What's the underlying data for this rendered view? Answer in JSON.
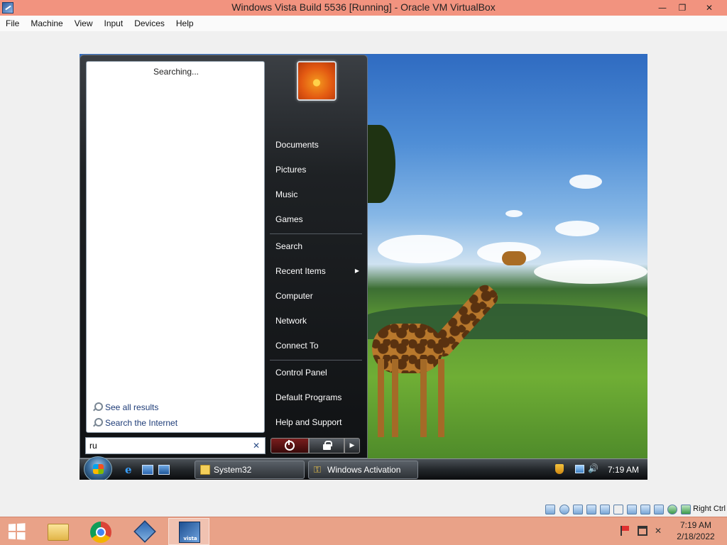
{
  "vbox": {
    "window_title": "Windows Vista Build 5536 [Running] - Oracle VM VirtualBox",
    "menu": [
      "File",
      "Machine",
      "View",
      "Input",
      "Devices",
      "Help"
    ],
    "controls": {
      "minimize": "—",
      "restore": "❐",
      "close": "✕"
    },
    "status": {
      "host_key": "Right Ctrl"
    }
  },
  "start_menu": {
    "searching_text": "Searching...",
    "search_links": [
      "See all results",
      "Search the Internet"
    ],
    "search_value": "ru",
    "clear_glyph": "✕",
    "user_name": "",
    "right_items": [
      "Documents",
      "Pictures",
      "Music",
      "Games"
    ],
    "right_items_2": [
      "Search",
      "Recent Items",
      "Computer",
      "Network",
      "Connect To"
    ],
    "right_items_3": [
      "Control Panel",
      "Default Programs",
      "Help and Support"
    ],
    "submenu_arrow": "▶",
    "more_glyph": "▶"
  },
  "vista_taskbar": {
    "tasks": [
      "System32",
      "Windows Activation"
    ],
    "clock": "7:19 AM",
    "ie_glyph": "e",
    "volume_glyph": "🔊"
  },
  "host_taskbar": {
    "clock_time": "7:19 AM",
    "clock_date": "2/18/2022",
    "vista_label": "vista",
    "volume_glyph": "✕"
  },
  "colors": {
    "vbox_titlebar": "#f2937f",
    "host_taskbar": "#e9a288",
    "start_menu_dark": "#1e2124"
  }
}
